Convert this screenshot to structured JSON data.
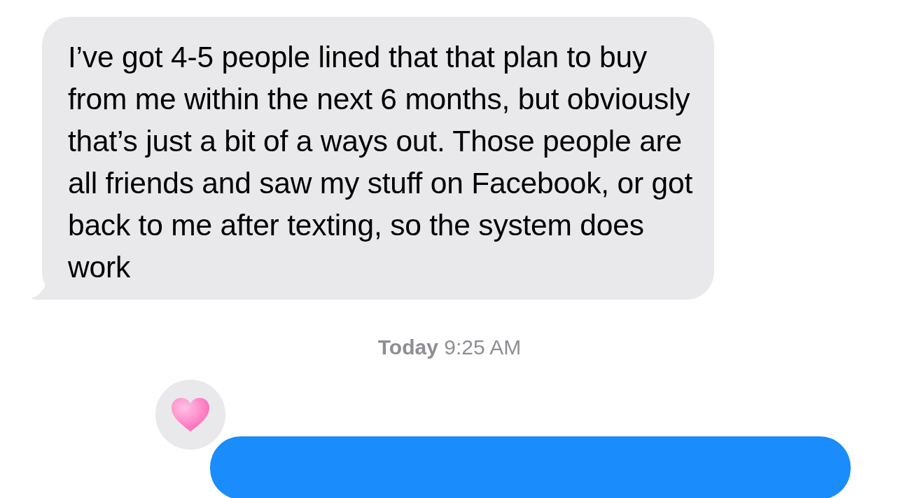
{
  "received_message": {
    "text": "I’ve got 4-5 people lined that that plan to buy from me within the next 6 months, but obviously that’s just a bit of a ways out. Those people are all friends and saw my stuff on Facebook, or got back to me after texting, so the system does work"
  },
  "timestamp": {
    "text": "**Today** 9:25 AM"
  },
  "sent_message": {
    "reaction": {
      "kind": "heart"
    }
  }
}
